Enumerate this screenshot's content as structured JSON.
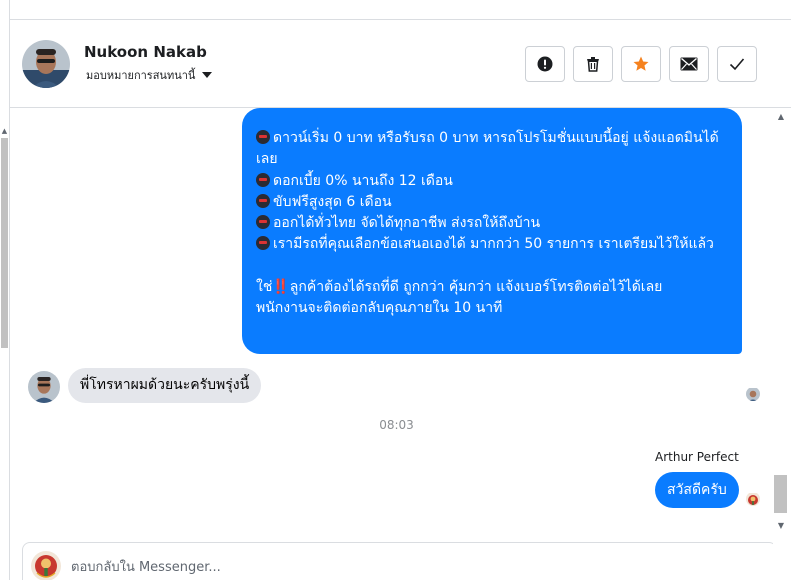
{
  "header": {
    "contact_name": "Nukoon Nakab",
    "assign_label": "มอบหมายการสนทนานี้",
    "actions": [
      {
        "name": "mark-spam-button",
        "icon": "exclamation-circle-icon"
      },
      {
        "name": "delete-button",
        "icon": "trash-icon"
      },
      {
        "name": "star-button",
        "icon": "star-icon"
      },
      {
        "name": "mark-unread-button",
        "icon": "envelope-icon"
      },
      {
        "name": "mark-done-button",
        "icon": "check-icon"
      }
    ]
  },
  "messages": {
    "promo_lines": [
      "ดาวน์เริ่ม 0 บาท หรือรับรถ 0 บาท หารถโปรโมชั่นแบบนี้อยู่ แจ้งแอดมินได้เลย",
      "ดอกเบี้ย 0% นานถึง 12 เดือน",
      "ขับฟรีสูงสุด 6 เดือน",
      "ออกได้ทั่วไทย จัดได้ทุกอาชีพ ส่งรถให้ถึงบ้าน",
      "เรามีรถที่คุณเลือกข้อเสนอเองได้ มากกว่า 50 รายการ เราเตรียมไว้ให้แล้ว"
    ],
    "promo_cta_prefix": "ใช่",
    "promo_cta_mark": "‼️",
    "promo_cta_rest": "ลูกค้าต้องได้รถที่ดี ถูกกว่า คุ้มกว่า แจ้งเบอร์โทรติดต่อไว้ได้เลย",
    "promo_cta_line2": "พนักงานจะติดต่อกลับคุณภายใน 10 นาที",
    "incoming_text": "พี่โทรหาผมด้วยนะครับพรุ่งนี้",
    "timestamp": "08:03",
    "outgoing_sender": "Arthur Perfect",
    "outgoing_text": "สวัสดีครับ"
  },
  "composer": {
    "placeholder": "ตอบกลับใน Messenger..."
  },
  "colors": {
    "accent_blue": "#0a7cff",
    "incoming_bubble": "#e4e6eb",
    "star_orange": "#f5821f"
  }
}
